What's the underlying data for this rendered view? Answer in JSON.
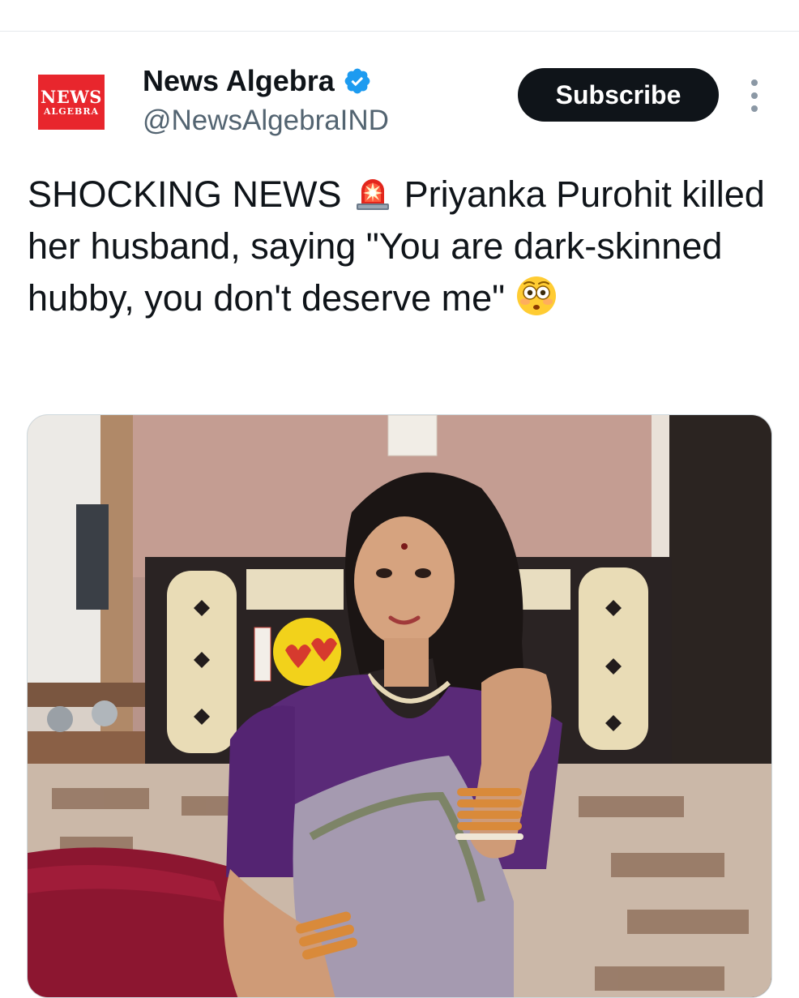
{
  "tweet": {
    "author": {
      "display_name": "News Algebra",
      "handle": "@NewsAlgebraIND",
      "avatar_line1": "NEWS",
      "avatar_line2": "ALGEBRA",
      "verified": true
    },
    "subscribe_label": "Subscribe",
    "text": {
      "part1": "SHOCKING NEWS",
      "emoji1": "police-car-light-emoji",
      "part2": "Priyanka Purohit killed her husband, saying \"You are dark-skinned hubby, you don't deserve me\"",
      "emoji2": "flushed-face-emoji"
    }
  },
  "colors": {
    "brand_red": "#e8262d",
    "verified_blue": "#1d9bf0",
    "text_primary": "#0f1419",
    "text_secondary": "#536471",
    "button_bg": "#0f1419"
  },
  "icons": {
    "verified": "verified-badge-icon",
    "more": "more-options-icon"
  }
}
